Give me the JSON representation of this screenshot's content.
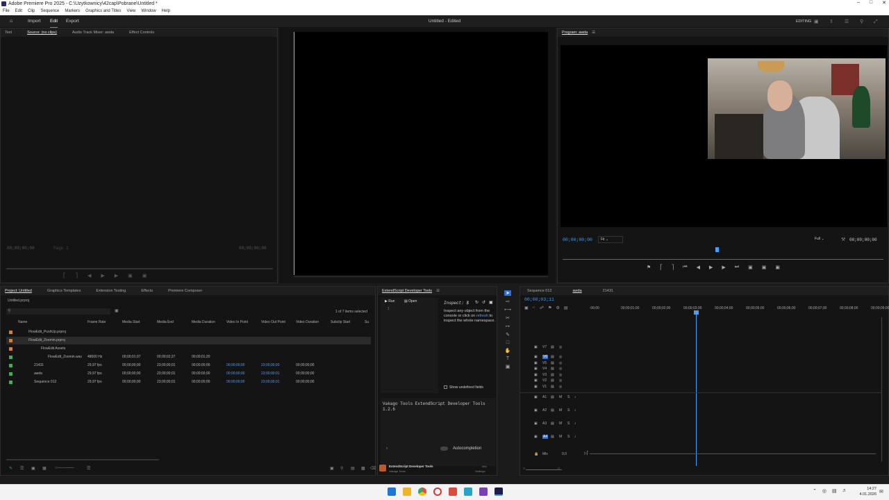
{
  "window": {
    "title": "Adobe Premiere Pro 2025 - C:\\Uzytkownicy\\42cap\\Pobrane\\Untitled *"
  },
  "menu": [
    "File",
    "Edit",
    "Clip",
    "Sequence",
    "Markers",
    "Graphics and Titles",
    "View",
    "Window",
    "Help"
  ],
  "header": {
    "workspaces": [
      "Import",
      "Edit",
      "Export"
    ],
    "doc_title": "Untitled - Edited",
    "mode": "EDITING"
  },
  "source_panel": {
    "tabs": [
      "Text",
      "Source: (no clips)",
      "Audio Track Mixer: awda",
      "Effect Controls"
    ],
    "tc_left": "00;00;00;00",
    "page": "Page 1",
    "tc_right": "00;00;00;00"
  },
  "program_panel": {
    "tab": "Program: awda",
    "tc_left": "00;00;00;00",
    "fit": "Fit",
    "quality": "Full",
    "tc_right": "00;00;00;00"
  },
  "project_panel": {
    "tabs": [
      "Project: Untitled",
      "Graphics Templates",
      "Extension Testing",
      "Effects",
      "Premiere Composer"
    ],
    "project_file": "Untitled.prproj",
    "items_selected": "1 of 7 items selected",
    "columns": [
      "Name",
      "Frame Rate",
      "Media Start",
      "Media End",
      "Media Duration",
      "Video In Point",
      "Video Out Point",
      "Video Duration",
      "Subclip Start",
      "Su"
    ],
    "rows": [
      {
        "name": "FlowEdit_PushUp.prproj",
        "fr": "",
        "ms": "",
        "me": "",
        "md": "",
        "vi": "",
        "vo": "",
        "vd": "",
        "color": "#e07a2a"
      },
      {
        "name": "FlowEdit_Zoomin.prproj",
        "fr": "",
        "ms": "",
        "me": "",
        "md": "",
        "vi": "",
        "vo": "",
        "vd": "",
        "color": "#e07a2a"
      },
      {
        "name": "FlowEdit Assets",
        "fr": "",
        "ms": "",
        "me": "",
        "md": "",
        "vi": "",
        "vo": "",
        "vd": "",
        "color": "#e07a2a"
      },
      {
        "name": "FlowEdit_Zoomin.wav",
        "fr": "48000 Hz",
        "ms": "00;00;01;07",
        "me": "00;00;02;27",
        "md": "00;00;01;20",
        "vi": "",
        "vo": "",
        "vd": "",
        "color": "#3bb54a"
      },
      {
        "name": "21431",
        "fr": "29,97 fps",
        "ms": "00;00;00;00",
        "me": "23;00;00;01",
        "md": "00;00;00;00",
        "vi": "00;00;00;00",
        "vo": "23;00;00;03",
        "vd": "00;00;00;00",
        "color": "#3bb54a"
      },
      {
        "name": "awda",
        "fr": "29,97 fps",
        "ms": "00;00;00;00",
        "me": "23;00;00;01",
        "md": "00;00;00;00",
        "vi": "00;00;00;00",
        "vo": "23;00;00;01",
        "vd": "00;00;00;00",
        "color": "#3bb54a"
      },
      {
        "name": "Sequence 012",
        "fr": "29,97 fps",
        "ms": "00;00;00;00",
        "me": "23;00;00;01",
        "md": "00;00;00;00",
        "vi": "00;00;00;00",
        "vo": "23;00;00;01",
        "vd": "00;00;00;00",
        "color": "#3bb54a"
      }
    ]
  },
  "devtools": {
    "tab": "ExtendScript Developer Tools",
    "run": "Run",
    "open": "Open",
    "line": "1",
    "inspect_title": "Inspect: $",
    "inspect_pre": "Inspect any object from the console or click on",
    "inspect_link": "refresh",
    "inspect_post": "to inspect the whole namespace.",
    "show_undefined": "Show undefined fields",
    "console_text": "Vakago Tools ExtendScript Developer Tools 1.2.6",
    "autocompletion": "Autocompletion",
    "footer_title": "ExtendScript Developer Tools",
    "footer_sub": "Vakago Tools",
    "footer_right1": "Info",
    "footer_right2": "Settings"
  },
  "timeline": {
    "tabs": [
      "Sequence 012",
      "awda",
      "21431"
    ],
    "tc": "00;00;03;11",
    "ruler": [
      ":00;00",
      "00;00;01;00",
      "00;00;02;00",
      "00;00;03;00",
      "00;00;04;00",
      "00;00;05;00",
      "00;00;06;00",
      "00;00;07;00",
      "00;00;08;00",
      "00;00;09;00"
    ],
    "video_tracks": [
      "V7",
      "V6",
      "V5",
      "V4",
      "V3",
      "V2",
      "V1"
    ],
    "audio_tracks": [
      "A1",
      "A2",
      "A3",
      "A4"
    ],
    "mix_label": "Mix",
    "mix_value": "0,0"
  },
  "taskbar": {
    "time": "14:27",
    "date": "4.01.2026"
  }
}
